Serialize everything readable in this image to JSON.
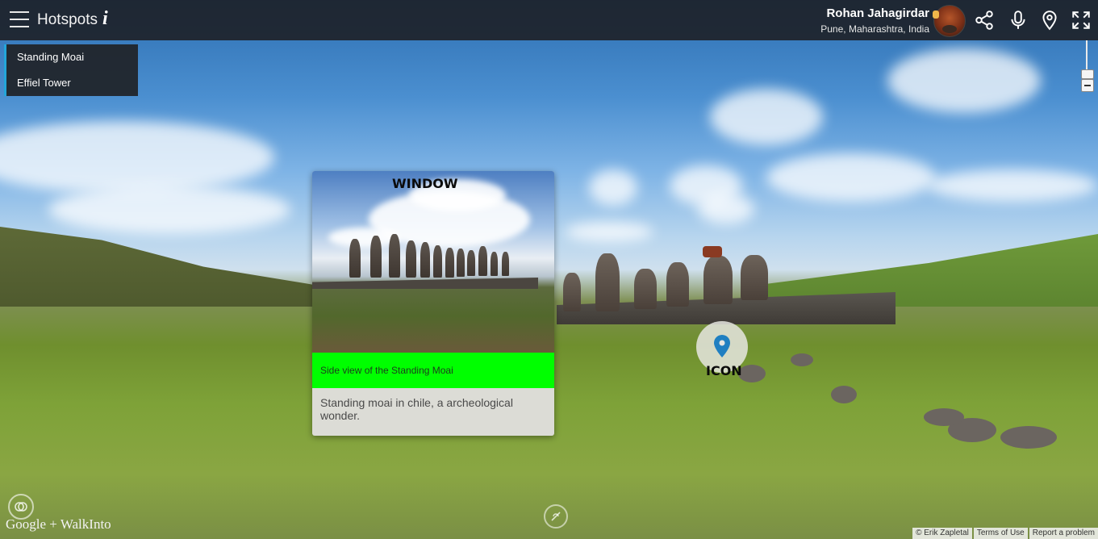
{
  "header": {
    "title": "Hotspots",
    "info_glyph": "i",
    "user_name": "Rohan Jahagirdar",
    "user_location": "Pune, Maharashtra, India",
    "icons": [
      "share-icon",
      "microphone-icon",
      "location-pin-icon",
      "fullscreen-icon"
    ]
  },
  "hotspot_list": {
    "items": [
      {
        "label": "Standing Moai"
      },
      {
        "label": "Effiel Tower"
      }
    ]
  },
  "card": {
    "overlay_label": "WINDOW",
    "caption": "Side view of the Standing Moai",
    "description": "Standing moai in chile, a archeological wonder."
  },
  "hotspot_icon": {
    "label": "ICON"
  },
  "branding": {
    "text": "Google + WalkInto"
  },
  "footer": {
    "links": [
      "© Erik Zapletal",
      "Terms of Use",
      "Report a problem"
    ]
  },
  "colors": {
    "caption_bg": "#00ff00",
    "list_accent": "#23a5d9",
    "pin": "#1f7fc1"
  }
}
